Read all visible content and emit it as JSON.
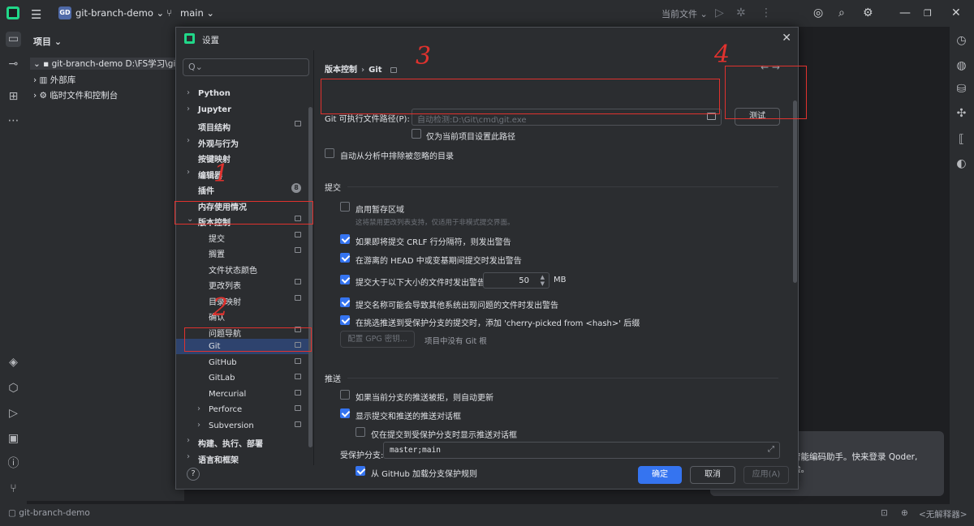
{
  "titlebar": {
    "project_badge": "GD",
    "project_name": "git-branch-demo ⌄",
    "branch": "main ⌄",
    "run_config": "当前文件 ⌄"
  },
  "project_panel": {
    "title": "项目 ⌄",
    "rows": [
      "⌄ ▪ git-branch-demo  D:\\FS学习\\git",
      "›  ▥ 外部库",
      "›  ⚙ 临时文件和控制台"
    ]
  },
  "dialog": {
    "title": "设置",
    "search_placeholder": "Q⌄",
    "nav": [
      {
        "label": "Python",
        "expandable": true,
        "gear": false
      },
      {
        "label": "Jupyter",
        "expandable": true,
        "gear": false
      },
      {
        "label": "项目结构",
        "expandable": false,
        "gear": true
      },
      {
        "label": "外观与行为",
        "expandable": true,
        "gear": false
      },
      {
        "label": "按键映射",
        "expandable": false,
        "gear": false
      },
      {
        "label": "编辑器",
        "expandable": true,
        "gear": false
      },
      {
        "label": "插件",
        "expandable": false,
        "gear": false,
        "badge": "8"
      },
      {
        "label": "内存使用情况",
        "expandable": false,
        "gear": false
      },
      {
        "label": "版本控制",
        "expandable": true,
        "expanded": true,
        "gear": true
      },
      {
        "label": "提交",
        "child": true,
        "gear": true
      },
      {
        "label": "搁置",
        "child": true,
        "gear": true
      },
      {
        "label": "文件状态颜色",
        "child": true,
        "gear": false
      },
      {
        "label": "更改列表",
        "child": true,
        "gear": true
      },
      {
        "label": "目录映射",
        "child": true,
        "gear": true
      },
      {
        "label": "确认",
        "child": true,
        "gear": false
      },
      {
        "label": "问题导航",
        "child": true,
        "gear": true
      },
      {
        "label": "Git",
        "child": true,
        "gear": true,
        "selected": true
      },
      {
        "label": "GitHub",
        "child": true,
        "gear": true
      },
      {
        "label": "GitLab",
        "child": true,
        "gear": true
      },
      {
        "label": "Mercurial",
        "child": true,
        "gear": true
      },
      {
        "label": "Perforce",
        "child": true,
        "expandable": true,
        "gear": true
      },
      {
        "label": "Subversion",
        "child": true,
        "expandable": true,
        "gear": true
      },
      {
        "label": "构建、执行、部署",
        "expandable": true,
        "gear": false
      },
      {
        "label": "语言和框架",
        "expandable": true,
        "gear": false
      }
    ],
    "breadcrumb": {
      "parent": "版本控制",
      "sep": "›",
      "current": "Git"
    },
    "nav_arrows": "←  →",
    "git_path": {
      "label": "Git 可执行文件路径(P):",
      "placeholder": "自动检测:D:\\Git\\cmd\\git.exe",
      "test_button": "测试",
      "only_current_label": "仅为当前项目设置此路径"
    },
    "auto_exclude_label": "自动从分析中排除被忽略的目录",
    "commit_section": "提交",
    "staging_label": "启用暂存区域",
    "staging_hint": "这将禁用更改列表支持，仅适用于非模式提交界面。",
    "crlf_label": "如果即将提交 CRLF 行分隔符，则发出警告",
    "detached_label": "在游离的 HEAD 中或变基期间提交时发出警告",
    "size_warn_label": "提交大于以下大小的文件时发出警告:",
    "size_value": "50",
    "size_unit": "MB",
    "bad_names_label": "提交名称可能会导致其他系统出现问题的文件时发出警告",
    "cherry_label": "在挑选推送到受保护分支的提交时，添加 'cherry-picked from <hash>' 后缀",
    "gpg_button": "配置 GPG 密钥...",
    "gpg_note": "项目中没有 Git 根",
    "push_section": "推送",
    "auto_update_label": "如果当前分支的推送被拒，则自动更新",
    "show_push_label": "显示提交和推送的推送对话框",
    "only_protected_label": "仅在提交到受保护分支时显示推送对话框",
    "protected_label": "受保护分支:",
    "protected_value": "master;main",
    "github_rules_label": "从 GitHub 加载分支保护规则",
    "ok": "确定",
    "cancel": "取消",
    "apply": "应用(A)",
    "help": "?"
  },
  "notification": {
    "line1": "你的智能编码助手。快来登录 Qoder,",
    "line2": "的体验。"
  },
  "statusbar": {
    "left": "▢ git-branch-demo",
    "right": "<无解释器>"
  },
  "annotations": {
    "n1": "1",
    "n2": "2",
    "n3": "3",
    "n4": "4"
  },
  "colors": {
    "accent": "#3574f0",
    "selection": "#2e436e",
    "annotation": "#e0322e"
  }
}
